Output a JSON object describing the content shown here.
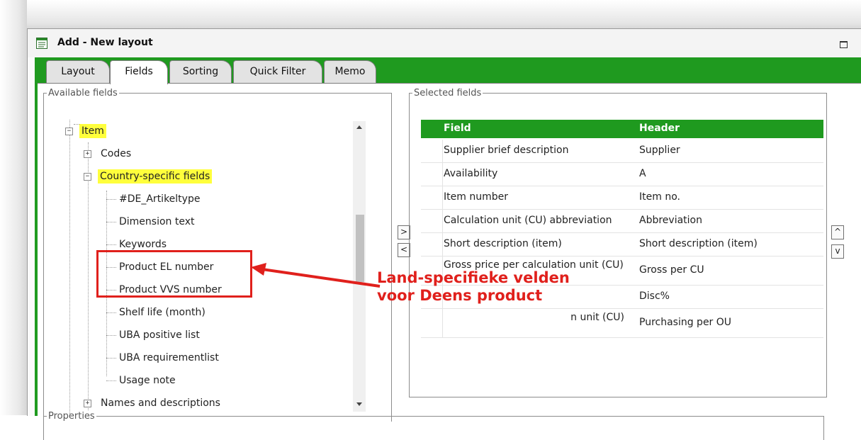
{
  "window": {
    "title": "Add - New layout"
  },
  "tabs": [
    {
      "label": "Layout",
      "active": false
    },
    {
      "label": "Fields",
      "active": true
    },
    {
      "label": "Sorting",
      "active": false
    },
    {
      "label": "Quick Filter",
      "active": false
    },
    {
      "label": "Memo",
      "active": false
    }
  ],
  "available_fields": {
    "legend": "Available fields",
    "tree": [
      {
        "label": "Item",
        "expander": "−",
        "highlighted": true
      },
      {
        "label": "Codes",
        "expander": "+"
      },
      {
        "label": "Country-specific fields",
        "expander": "−",
        "highlighted": true
      },
      {
        "label": "#DE_Artikeltype"
      },
      {
        "label": "Dimension text"
      },
      {
        "label": "Keywords"
      },
      {
        "label": "Product EL number"
      },
      {
        "label": "Product VVS number"
      },
      {
        "label": "Shelf life (month)"
      },
      {
        "label": "UBA positive list"
      },
      {
        "label": "UBA requirementlist"
      },
      {
        "label": "Usage note"
      },
      {
        "label": "Names and descriptions",
        "expander": "+"
      }
    ]
  },
  "move_buttons": {
    "add": ">",
    "remove": "<"
  },
  "order_buttons": {
    "up": "^",
    "down": "v"
  },
  "selected_fields": {
    "legend": "Selected fields",
    "columns": [
      "Field",
      "Header"
    ],
    "rows": [
      [
        "Supplier brief description",
        "Supplier"
      ],
      [
        "Availability",
        "A"
      ],
      [
        "Item number",
        "Item no."
      ],
      [
        "Calculation unit (CU) abbreviation",
        "Abbreviation"
      ],
      [
        "Short description (item)",
        "Short description (item)"
      ],
      [
        "Gross price per calculation unit (CU)",
        "Gross per CU"
      ],
      [
        "",
        "Disc%"
      ],
      [
        "n unit (CU)",
        "Purchasing per OU"
      ]
    ]
  },
  "properties": {
    "legend": "Properties"
  },
  "annotation": {
    "line1": "Land-specifieke velden",
    "line2": "voor Deens product",
    "color": "#e0201c"
  },
  "colors": {
    "accent_green": "#1f9a1f",
    "highlight_yellow": "#ffff3c"
  }
}
